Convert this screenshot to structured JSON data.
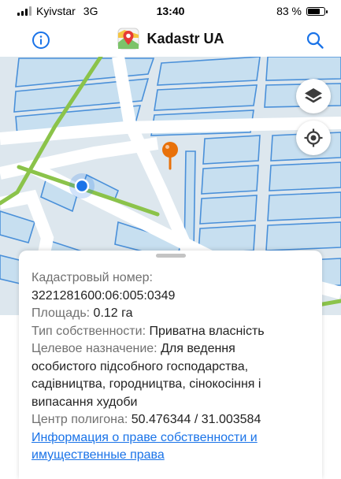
{
  "status_bar": {
    "carrier": "Kyivstar",
    "network": "3G",
    "time": "13:40",
    "battery_percent": "83 %",
    "battery_level": 0.83
  },
  "header": {
    "title": "Kadastr UA",
    "info_icon": "info-icon",
    "logo_icon": "map-pin-logo-icon",
    "search_icon": "search-icon"
  },
  "map": {
    "layers_icon": "layers-icon",
    "locate_icon": "locate-icon",
    "pin_color": "#e8710a",
    "user_dot_color": "#1a73e8",
    "road_color": "#8bc34a"
  },
  "parcel": {
    "cadastral_label": "Кадастровый номер:",
    "cadastral_number": "3221281600:06:005:0349",
    "area_label": "Площадь:",
    "area_value": "0.12 га",
    "ownership_label": "Тип собственности:",
    "ownership_value": "Приватна власність",
    "purpose_label": "Целевое назначение:",
    "purpose_value_line1": "Для ведення",
    "purpose_value_line2": "особистого підсобного господарства,",
    "purpose_value_line3": "садівництва, городництва, сінокосіння і",
    "purpose_value_line4": "випасання худоби",
    "center_label": "Центр полигона:",
    "center_value": "50.476344 / 31.003584",
    "rights_link_line1": "Информация о праве собственности и",
    "rights_link_line2": "имущественные права"
  }
}
